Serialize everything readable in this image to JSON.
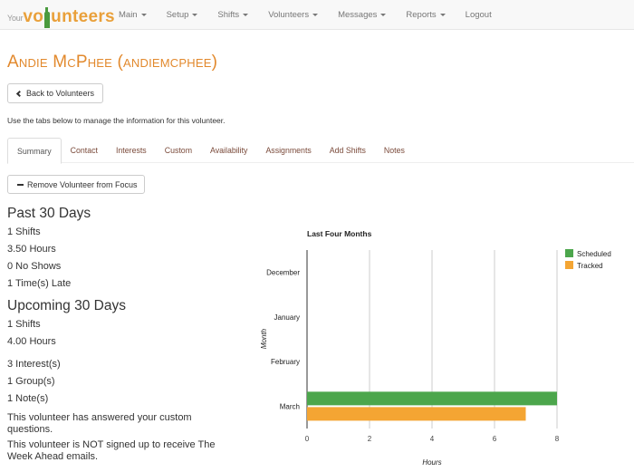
{
  "brand": {
    "prefix": "Your",
    "name_part1": "vo",
    "name_part2": "unteers"
  },
  "nav": {
    "items": [
      {
        "label": "Main",
        "dropdown": true
      },
      {
        "label": "Setup",
        "dropdown": true
      },
      {
        "label": "Shifts",
        "dropdown": true
      },
      {
        "label": "Volunteers",
        "dropdown": true
      },
      {
        "label": "Messages",
        "dropdown": true
      },
      {
        "label": "Reports",
        "dropdown": true
      },
      {
        "label": "Logout",
        "dropdown": false
      }
    ]
  },
  "page": {
    "title": "Andie McPhee (andiemcphee)",
    "back_button": "Back to Volunteers",
    "intro": "Use the tabs below to manage the information for this volunteer.",
    "remove_button": "Remove Volunteer from Focus"
  },
  "tabs": [
    {
      "label": "Summary",
      "active": true
    },
    {
      "label": "Contact",
      "active": false
    },
    {
      "label": "Interests",
      "active": false
    },
    {
      "label": "Custom",
      "active": false
    },
    {
      "label": "Availability",
      "active": false
    },
    {
      "label": "Assignments",
      "active": false
    },
    {
      "label": "Add Shifts",
      "active": false
    },
    {
      "label": "Notes",
      "active": false
    }
  ],
  "summary": {
    "past": {
      "heading": "Past 30 Days",
      "shifts": "1 Shifts",
      "hours": "3.50 Hours",
      "no_shows": "0 No Shows",
      "late": "1 Time(s) Late"
    },
    "upcoming": {
      "heading": "Upcoming 30 Days",
      "shifts": "1 Shifts",
      "hours": "4.00 Hours"
    },
    "interests": "3 Interest(s)",
    "groups": "1 Group(s)",
    "notes": "1 Note(s)",
    "custom_status": "This volunteer has answered your custom questions.",
    "email_status": "This volunteer is NOT signed up to receive The Week Ahead emails."
  },
  "colors": {
    "accent": "#e2892d",
    "scheduled": "#4ca64c",
    "tracked": "#f4a533"
  },
  "chart_data": {
    "type": "bar",
    "orientation": "horizontal",
    "title": "Last Four Months",
    "xlabel": "Hours",
    "ylabel": "Month",
    "categories": [
      "December",
      "January",
      "February",
      "March"
    ],
    "series": [
      {
        "name": "Scheduled",
        "color": "#4ca64c",
        "values": [
          0,
          0,
          0,
          8
        ]
      },
      {
        "name": "Tracked",
        "color": "#f4a533",
        "values": [
          0,
          0,
          0,
          7
        ]
      }
    ],
    "xlim": [
      0,
      8
    ],
    "xticks": [
      "0",
      "2",
      "4",
      "6",
      "8"
    ],
    "grid": true,
    "legend_position": "right"
  }
}
